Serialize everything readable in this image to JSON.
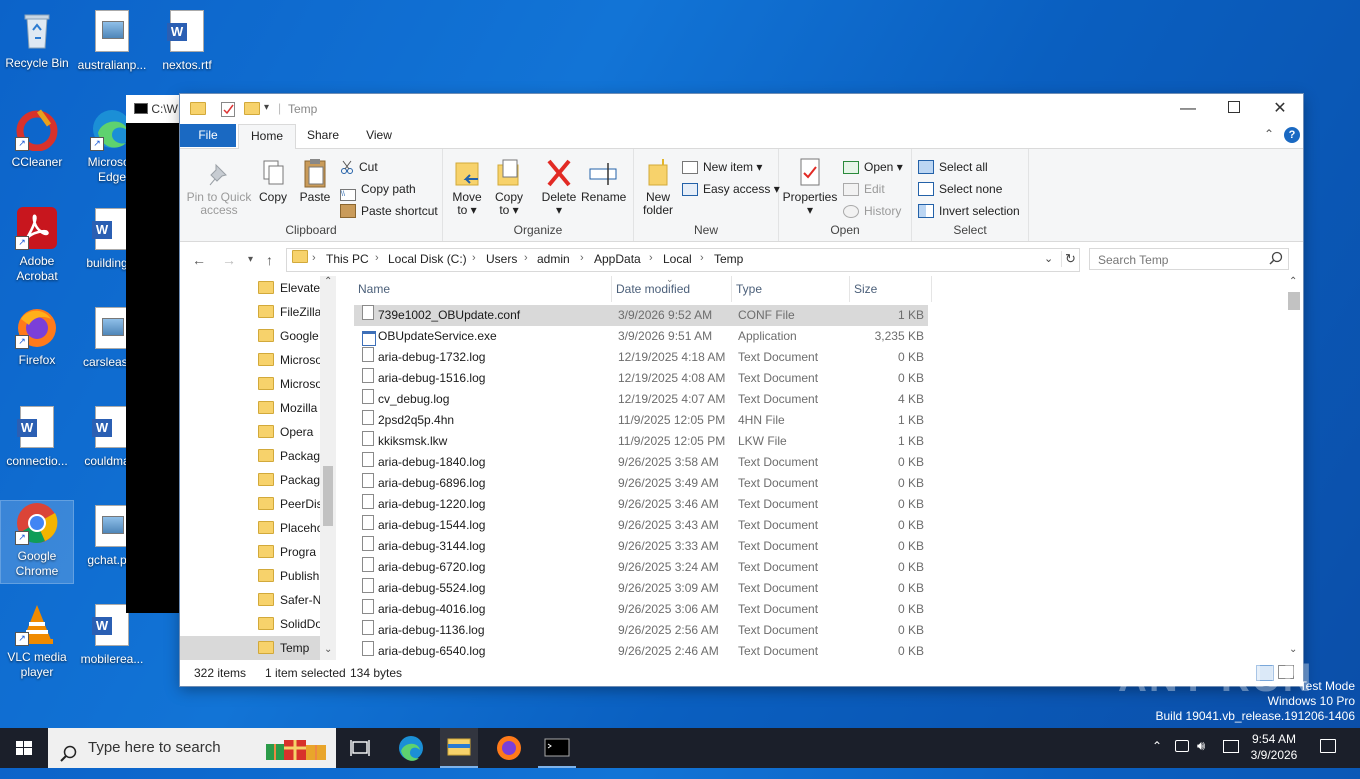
{
  "desktop": {
    "icons": [
      {
        "label": "Recycle Bin"
      },
      {
        "label": "australianp..."
      },
      {
        "label": "nextos.rtf"
      },
      {
        "label": "CCleaner"
      },
      {
        "label": "Microsoft Edge"
      },
      {
        "label": "Adobe Acrobat"
      },
      {
        "label": "building..."
      },
      {
        "label": "Firefox"
      },
      {
        "label": "carsleast..."
      },
      {
        "label": "connectio..."
      },
      {
        "label": "couldma..."
      },
      {
        "label": "Google Chrome"
      },
      {
        "label": "gchat.p..."
      },
      {
        "label": "VLC media player"
      },
      {
        "label": "mobilerea..."
      }
    ],
    "cmd_title": "C:\\W"
  },
  "explorer": {
    "title": "Temp",
    "tabs": {
      "file": "File",
      "home": "Home",
      "share": "Share",
      "view": "View"
    },
    "ribbon": {
      "clipboard": {
        "label": "Clipboard",
        "pin": "Pin to Quick access",
        "copy": "Copy",
        "paste": "Paste",
        "cut": "Cut",
        "copy_path": "Copy path",
        "paste_shortcut": "Paste shortcut"
      },
      "organize": {
        "label": "Organize",
        "move_to": "Move to",
        "copy_to": "Copy to",
        "delete": "Delete",
        "rename": "Rename"
      },
      "new": {
        "label": "New",
        "new_folder": "New folder",
        "new_item": "New item",
        "easy_access": "Easy access"
      },
      "open": {
        "label": "Open",
        "properties": "Properties",
        "open": "Open",
        "edit": "Edit",
        "history": "History"
      },
      "select": {
        "label": "Select",
        "select_all": "Select all",
        "select_none": "Select none",
        "invert": "Invert selection"
      }
    },
    "address": {
      "crumbs": [
        "This PC",
        "Local Disk (C:)",
        "Users",
        "admin",
        "AppData",
        "Local",
        "Temp"
      ],
      "search_placeholder": "Search Temp"
    },
    "nav_items": [
      "Elevate",
      "FileZilla",
      "Google",
      "Microso",
      "Microso",
      "Mozilla",
      "Opera",
      "Packag",
      "Packag",
      "PeerDis",
      "Placeho",
      "Progra",
      "Publish",
      "Safer-N",
      "SolidDo",
      "Temp"
    ],
    "columns": {
      "name": "Name",
      "date": "Date modified",
      "type": "Type",
      "size": "Size"
    },
    "files": [
      {
        "name": "739e1002_OBUpdate.conf",
        "date": "3/9/2026 9:52 AM",
        "type": "CONF File",
        "size": "1 KB"
      },
      {
        "name": "OBUpdateService.exe",
        "date": "3/9/2026 9:51 AM",
        "type": "Application",
        "size": "3,235 KB"
      },
      {
        "name": "aria-debug-1732.log",
        "date": "12/19/2025 4:18 AM",
        "type": "Text Document",
        "size": "0 KB"
      },
      {
        "name": "aria-debug-1516.log",
        "date": "12/19/2025 4:08 AM",
        "type": "Text Document",
        "size": "0 KB"
      },
      {
        "name": "cv_debug.log",
        "date": "12/19/2025 4:07 AM",
        "type": "Text Document",
        "size": "4 KB"
      },
      {
        "name": "2psd2q5p.4hn",
        "date": "11/9/2025 12:05 PM",
        "type": "4HN File",
        "size": "1 KB"
      },
      {
        "name": "kkiksmsk.lkw",
        "date": "11/9/2025 12:05 PM",
        "type": "LKW File",
        "size": "1 KB"
      },
      {
        "name": "aria-debug-1840.log",
        "date": "9/26/2025 3:58 AM",
        "type": "Text Document",
        "size": "0 KB"
      },
      {
        "name": "aria-debug-6896.log",
        "date": "9/26/2025 3:49 AM",
        "type": "Text Document",
        "size": "0 KB"
      },
      {
        "name": "aria-debug-1220.log",
        "date": "9/26/2025 3:46 AM",
        "type": "Text Document",
        "size": "0 KB"
      },
      {
        "name": "aria-debug-1544.log",
        "date": "9/26/2025 3:43 AM",
        "type": "Text Document",
        "size": "0 KB"
      },
      {
        "name": "aria-debug-3144.log",
        "date": "9/26/2025 3:33 AM",
        "type": "Text Document",
        "size": "0 KB"
      },
      {
        "name": "aria-debug-6720.log",
        "date": "9/26/2025 3:24 AM",
        "type": "Text Document",
        "size": "0 KB"
      },
      {
        "name": "aria-debug-5524.log",
        "date": "9/26/2025 3:09 AM",
        "type": "Text Document",
        "size": "0 KB"
      },
      {
        "name": "aria-debug-4016.log",
        "date": "9/26/2025 3:06 AM",
        "type": "Text Document",
        "size": "0 KB"
      },
      {
        "name": "aria-debug-1136.log",
        "date": "9/26/2025 2:56 AM",
        "type": "Text Document",
        "size": "0 KB"
      },
      {
        "name": "aria-debug-6540.log",
        "date": "9/26/2025 2:46 AM",
        "type": "Text Document",
        "size": "0 KB"
      }
    ],
    "status": {
      "count": "322 items",
      "selected": "1 item selected",
      "bytes": "134 bytes"
    }
  },
  "taskbar": {
    "search_placeholder": "Type here to search",
    "time": "9:54 AM",
    "date": "3/9/2026"
  },
  "watermark": {
    "mode": "Test Mode",
    "edition": "Windows 10 Pro",
    "build": "Build 19041.vb_release.191206-1406",
    "brand": "ANY RUN"
  }
}
